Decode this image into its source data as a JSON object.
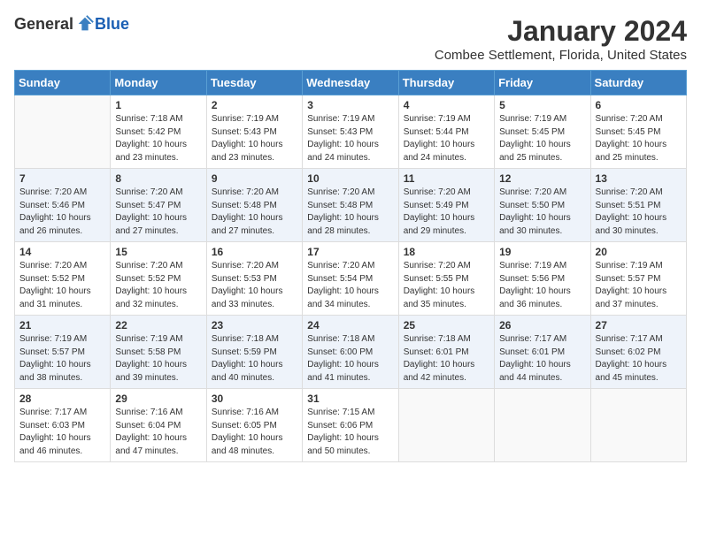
{
  "header": {
    "logo_general": "General",
    "logo_blue": "Blue",
    "title": "January 2024",
    "subtitle": "Combee Settlement, Florida, United States"
  },
  "calendar": {
    "days_of_week": [
      "Sunday",
      "Monday",
      "Tuesday",
      "Wednesday",
      "Thursday",
      "Friday",
      "Saturday"
    ],
    "weeks": [
      [
        {
          "day": "",
          "info": ""
        },
        {
          "day": "1",
          "info": "Sunrise: 7:18 AM\nSunset: 5:42 PM\nDaylight: 10 hours\nand 23 minutes."
        },
        {
          "day": "2",
          "info": "Sunrise: 7:19 AM\nSunset: 5:43 PM\nDaylight: 10 hours\nand 23 minutes."
        },
        {
          "day": "3",
          "info": "Sunrise: 7:19 AM\nSunset: 5:43 PM\nDaylight: 10 hours\nand 24 minutes."
        },
        {
          "day": "4",
          "info": "Sunrise: 7:19 AM\nSunset: 5:44 PM\nDaylight: 10 hours\nand 24 minutes."
        },
        {
          "day": "5",
          "info": "Sunrise: 7:19 AM\nSunset: 5:45 PM\nDaylight: 10 hours\nand 25 minutes."
        },
        {
          "day": "6",
          "info": "Sunrise: 7:20 AM\nSunset: 5:45 PM\nDaylight: 10 hours\nand 25 minutes."
        }
      ],
      [
        {
          "day": "7",
          "info": "Sunrise: 7:20 AM\nSunset: 5:46 PM\nDaylight: 10 hours\nand 26 minutes."
        },
        {
          "day": "8",
          "info": "Sunrise: 7:20 AM\nSunset: 5:47 PM\nDaylight: 10 hours\nand 27 minutes."
        },
        {
          "day": "9",
          "info": "Sunrise: 7:20 AM\nSunset: 5:48 PM\nDaylight: 10 hours\nand 27 minutes."
        },
        {
          "day": "10",
          "info": "Sunrise: 7:20 AM\nSunset: 5:48 PM\nDaylight: 10 hours\nand 28 minutes."
        },
        {
          "day": "11",
          "info": "Sunrise: 7:20 AM\nSunset: 5:49 PM\nDaylight: 10 hours\nand 29 minutes."
        },
        {
          "day": "12",
          "info": "Sunrise: 7:20 AM\nSunset: 5:50 PM\nDaylight: 10 hours\nand 30 minutes."
        },
        {
          "day": "13",
          "info": "Sunrise: 7:20 AM\nSunset: 5:51 PM\nDaylight: 10 hours\nand 30 minutes."
        }
      ],
      [
        {
          "day": "14",
          "info": "Sunrise: 7:20 AM\nSunset: 5:52 PM\nDaylight: 10 hours\nand 31 minutes."
        },
        {
          "day": "15",
          "info": "Sunrise: 7:20 AM\nSunset: 5:52 PM\nDaylight: 10 hours\nand 32 minutes."
        },
        {
          "day": "16",
          "info": "Sunrise: 7:20 AM\nSunset: 5:53 PM\nDaylight: 10 hours\nand 33 minutes."
        },
        {
          "day": "17",
          "info": "Sunrise: 7:20 AM\nSunset: 5:54 PM\nDaylight: 10 hours\nand 34 minutes."
        },
        {
          "day": "18",
          "info": "Sunrise: 7:20 AM\nSunset: 5:55 PM\nDaylight: 10 hours\nand 35 minutes."
        },
        {
          "day": "19",
          "info": "Sunrise: 7:19 AM\nSunset: 5:56 PM\nDaylight: 10 hours\nand 36 minutes."
        },
        {
          "day": "20",
          "info": "Sunrise: 7:19 AM\nSunset: 5:57 PM\nDaylight: 10 hours\nand 37 minutes."
        }
      ],
      [
        {
          "day": "21",
          "info": "Sunrise: 7:19 AM\nSunset: 5:57 PM\nDaylight: 10 hours\nand 38 minutes."
        },
        {
          "day": "22",
          "info": "Sunrise: 7:19 AM\nSunset: 5:58 PM\nDaylight: 10 hours\nand 39 minutes."
        },
        {
          "day": "23",
          "info": "Sunrise: 7:18 AM\nSunset: 5:59 PM\nDaylight: 10 hours\nand 40 minutes."
        },
        {
          "day": "24",
          "info": "Sunrise: 7:18 AM\nSunset: 6:00 PM\nDaylight: 10 hours\nand 41 minutes."
        },
        {
          "day": "25",
          "info": "Sunrise: 7:18 AM\nSunset: 6:01 PM\nDaylight: 10 hours\nand 42 minutes."
        },
        {
          "day": "26",
          "info": "Sunrise: 7:17 AM\nSunset: 6:01 PM\nDaylight: 10 hours\nand 44 minutes."
        },
        {
          "day": "27",
          "info": "Sunrise: 7:17 AM\nSunset: 6:02 PM\nDaylight: 10 hours\nand 45 minutes."
        }
      ],
      [
        {
          "day": "28",
          "info": "Sunrise: 7:17 AM\nSunset: 6:03 PM\nDaylight: 10 hours\nand 46 minutes."
        },
        {
          "day": "29",
          "info": "Sunrise: 7:16 AM\nSunset: 6:04 PM\nDaylight: 10 hours\nand 47 minutes."
        },
        {
          "day": "30",
          "info": "Sunrise: 7:16 AM\nSunset: 6:05 PM\nDaylight: 10 hours\nand 48 minutes."
        },
        {
          "day": "31",
          "info": "Sunrise: 7:15 AM\nSunset: 6:06 PM\nDaylight: 10 hours\nand 50 minutes."
        },
        {
          "day": "",
          "info": ""
        },
        {
          "day": "",
          "info": ""
        },
        {
          "day": "",
          "info": ""
        }
      ]
    ]
  }
}
